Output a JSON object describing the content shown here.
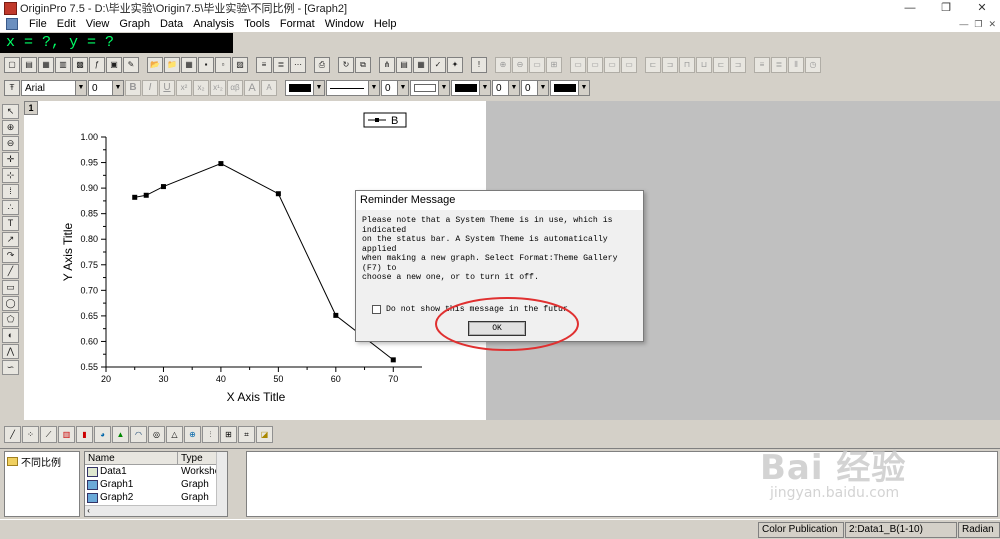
{
  "window": {
    "title": "OriginPro 7.5 - D:\\毕业实验\\Origin7.5\\毕业实验\\不同比例 - [Graph2]",
    "controls": [
      "—",
      "❐",
      "✕"
    ]
  },
  "menu": {
    "items": [
      "File",
      "Edit",
      "View",
      "Graph",
      "Data",
      "Analysis",
      "Tools",
      "Format",
      "Window",
      "Help"
    ],
    "mdi_controls": [
      "—",
      "❐",
      "✕"
    ]
  },
  "readout": "x = ?, y = ?",
  "format_toolbar": {
    "font": "Arial",
    "size": "0",
    "bold": "B",
    "italic": "I",
    "underline": "U",
    "sup": "x²",
    "sub": "x₂",
    "supsub": "x¹₂",
    "greek": "αβ",
    "larger": "A",
    "smaller": "A",
    "num1": "0",
    "num2": "0",
    "num3": "0"
  },
  "graph": {
    "layer": "1",
    "legend_label": "B",
    "xlabel": "X Axis Title",
    "ylabel": "Y Axis Title"
  },
  "chart_data": {
    "type": "line",
    "series": [
      {
        "name": "B",
        "x": [
          25,
          27,
          30,
          40,
          50,
          60,
          70
        ],
        "y": [
          0.882,
          0.886,
          0.903,
          0.948,
          0.889,
          0.651,
          0.564
        ]
      }
    ],
    "xlabel": "X Axis Title",
    "ylabel": "Y Axis Title",
    "xlim": [
      20,
      75
    ],
    "ylim": [
      0.55,
      1.0
    ],
    "xticks": [
      "20",
      "30",
      "40",
      "50",
      "60",
      "70"
    ],
    "yticks": [
      "0.55",
      "0.60",
      "0.65",
      "0.70",
      "0.75",
      "0.80",
      "0.85",
      "0.90",
      "0.95",
      "1.00"
    ],
    "grid": false,
    "legend": "top-right"
  },
  "dialog": {
    "title": "Reminder Message",
    "lines": [
      "Please note that a System Theme is in use, which is indicated",
      "on the status bar. A System Theme is automatically applied",
      "when making a new graph. Select Format:Theme Gallery (F7) to",
      "choose a new one, or to turn it off."
    ],
    "checkbox_label": "Do not show this message in the futur",
    "ok_label": "OK"
  },
  "explorer": {
    "folder": "不同比例",
    "columns": [
      "Name",
      "Type"
    ],
    "rows": [
      {
        "name": "Data1",
        "type": "Workshe"
      },
      {
        "name": "Graph1",
        "type": "Graph"
      },
      {
        "name": "Graph2",
        "type": "Graph"
      }
    ]
  },
  "statusbar": {
    "theme": "Color Publication",
    "active": "2:Data1_B(1-10)",
    "angle": "Radian"
  },
  "watermark": {
    "main": "Bai 经验",
    "sub": "jingyan.baidu.com"
  },
  "colors": {
    "readout_bg": "#000000",
    "readout_fg": "#00ff66",
    "annotation": "#e03030",
    "gray_area": "#c0c0c0"
  }
}
